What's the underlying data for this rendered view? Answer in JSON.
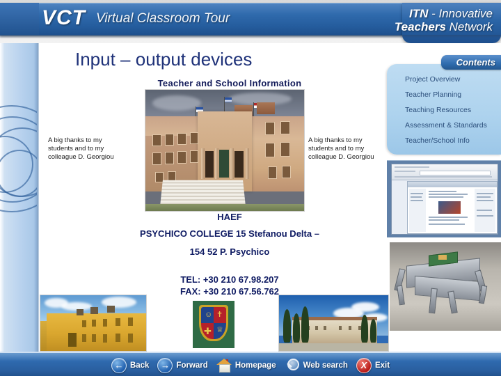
{
  "header": {
    "logo": "VCT",
    "logo_subtitle": "Virtual Classroom Tour",
    "brand_line1_bold": "ITN",
    "brand_line1_rest": " - Innovative",
    "brand_line2_bold": "Teachers",
    "brand_line2_rest": " Network"
  },
  "slide": {
    "title": "Input – output devices",
    "subtitle": "Teacher and School Information",
    "thanks_left": "A big thanks to my\nstudents and to my\ncolleague D. Georgiou",
    "thanks_right": "A big thanks to my\nstudents and to my\ncolleague D. Georgiou",
    "address": {
      "school_abbr": "HAEF",
      "school_name": "PSYCHICO COLLEGE 15 Stefanou Delta –",
      "postal": "154 52 P. Psychico",
      "tel": "TEL: +30 210 67.98.207",
      "fax": "FAX: +30 210 67.56.762"
    }
  },
  "contents": {
    "tab_label": "Contents",
    "items": [
      {
        "label": "Project Overview"
      },
      {
        "label": "Teacher Planning"
      },
      {
        "label": "Teaching  Resources"
      },
      {
        "label": "Assessment & Standards"
      },
      {
        "label": "Teacher/School Info"
      }
    ]
  },
  "navbar": {
    "buttons": [
      {
        "label": "Back",
        "icon": "arrow-left-icon"
      },
      {
        "label": "Forward",
        "icon": "arrow-right-icon"
      },
      {
        "label": "Homepage",
        "icon": "house-icon"
      },
      {
        "label": "Web search",
        "icon": "magnifier-icon"
      },
      {
        "label": "Exit",
        "icon": "close-x-icon"
      }
    ],
    "arrow_left_glyph": "←",
    "arrow_right_glyph": "→",
    "exit_glyph": "X"
  },
  "colors": {
    "header_blue": "#2f6aac",
    "title_navy": "#1f3279",
    "address_navy": "#0f1b63",
    "panel_blue": "#aed3ee",
    "contents_text": "#2c4f7c",
    "navbar_blue": "#2a5fa0",
    "exit_red": "#b91c18"
  }
}
